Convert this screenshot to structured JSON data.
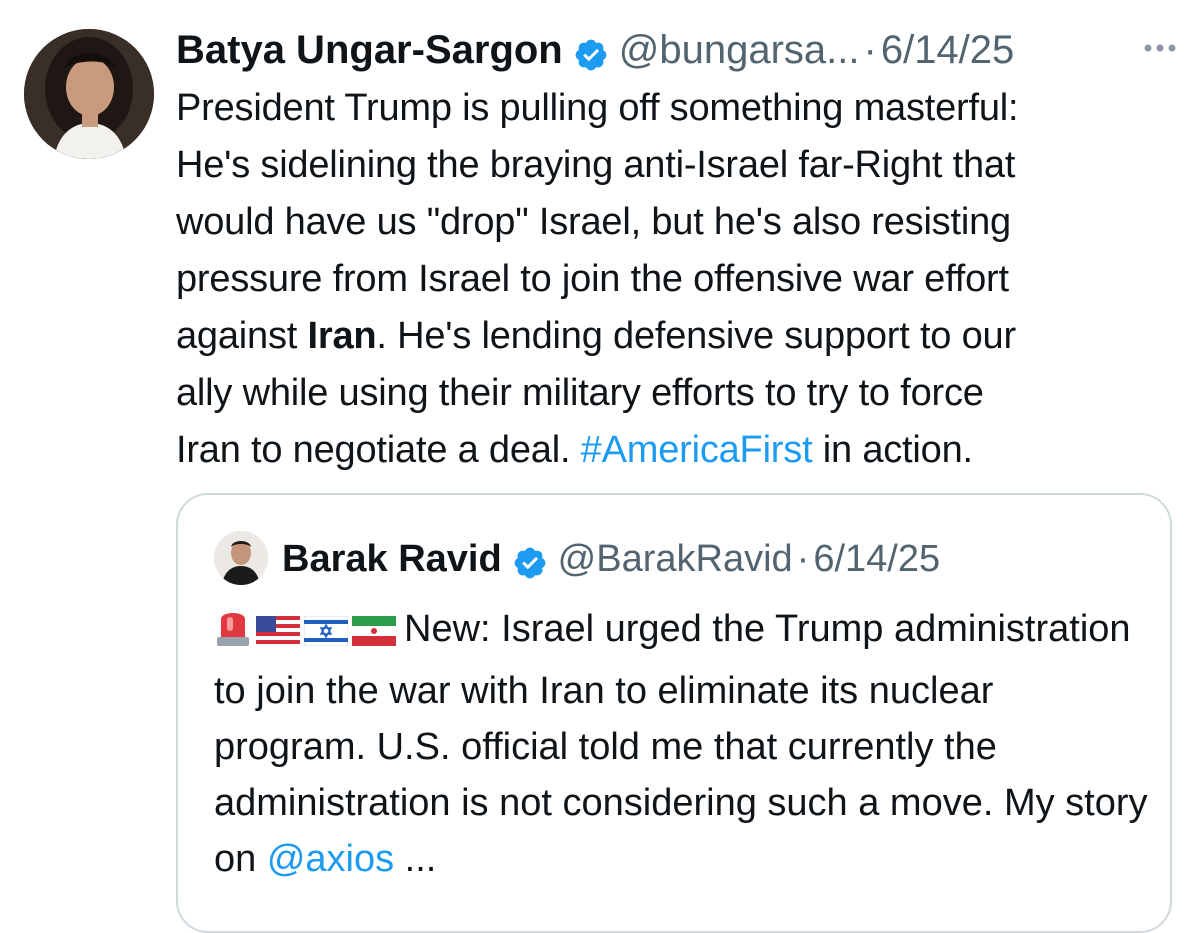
{
  "tweet": {
    "author_name": "Batya Ungar-Sargon",
    "handle": "@bungarsa...",
    "separator": "·",
    "date": "6/14/25",
    "text_part1": "President Trump is pulling off something masterful:\nHe's sidelining the braying anti-Israel far-Right that\nwould have us \"drop\" Israel, but he's also resisting\npressure from Israel to join the offensive war effort\nagainst ",
    "text_bold": "Iran",
    "text_part2": ". He's lending defensive support to our\nally while using their military efforts to try to force\nIran to negotiate a deal. ",
    "hashtag": "#AmericaFirst",
    "text_part3": " in action."
  },
  "quoted_tweet": {
    "author_name": "Barak Ravid",
    "handle": "@BarakRavid",
    "separator": "·",
    "date": "6/14/25",
    "emoji_icons": [
      "police-light-icon",
      "us-flag-icon",
      "israel-flag-icon",
      "iran-flag-icon"
    ],
    "text_part1": "New: Israel urged the Trump administration to join the war with Iran to eliminate its nuclear program. U.S. official told me that currently the administration is not considering such a move. My story on ",
    "mention": "@axios",
    "ellipsis": " ..."
  },
  "colors": {
    "link": "#1d9bf0",
    "verified": "#1d9bf0",
    "secondary_text": "#536471",
    "border": "#cfd9de"
  }
}
